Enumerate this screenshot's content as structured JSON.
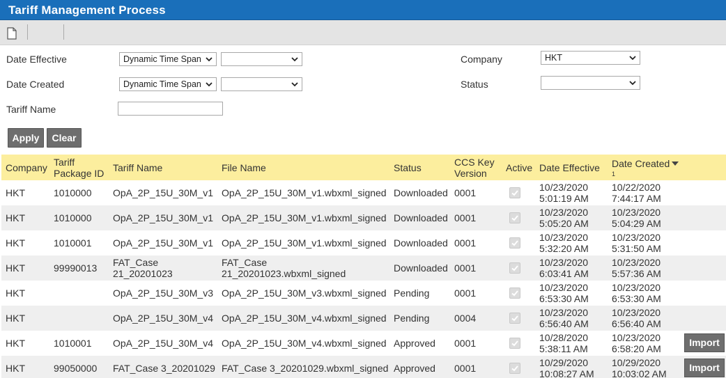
{
  "window": {
    "title": "Tariff Management Process"
  },
  "toolbar": {
    "new_icon": "new-document-icon"
  },
  "filters": {
    "date_effective": {
      "label": "Date Effective",
      "mode": "Dynamic Time Span",
      "range": ""
    },
    "date_created": {
      "label": "Date Created",
      "mode": "Dynamic Time Span",
      "range": ""
    },
    "tariff_name": {
      "label": "Tariff Name",
      "value": ""
    },
    "company": {
      "label": "Company",
      "value": "HKT"
    },
    "status": {
      "label": "Status",
      "value": ""
    }
  },
  "actions": {
    "apply": "Apply",
    "clear": "Clear"
  },
  "table": {
    "columns": {
      "company": "Company",
      "package_id_1": "Tariff",
      "package_id_2": "Package ID",
      "tariff_name": "Tariff Name",
      "file_name": "File Name",
      "status": "Status",
      "ccs_1": "CCS Key",
      "ccs_2": "Version",
      "active": "Active",
      "date_effective": "Date Effective",
      "date_created": "Date Created",
      "sort_order": "1"
    },
    "rows": [
      {
        "company": "HKT",
        "package_id": "1010000",
        "tariff_name": [
          "OpA_2P_15U_30M_v1"
        ],
        "file_name": [
          "OpA_2P_15U_30M_v1.wbxml_signed"
        ],
        "status": "Downloaded",
        "ccs": "0001",
        "active": true,
        "eff_date": "10/23/2020",
        "eff_time": "5:01:19 AM",
        "cre_date": "10/22/2020",
        "cre_time": "7:44:17 AM",
        "import": ""
      },
      {
        "company": "HKT",
        "package_id": "1010000",
        "tariff_name": [
          "OpA_2P_15U_30M_v1"
        ],
        "file_name": [
          "OpA_2P_15U_30M_v1.wbxml_signed"
        ],
        "status": "Downloaded",
        "ccs": "0001",
        "active": true,
        "eff_date": "10/23/2020",
        "eff_time": "5:05:20 AM",
        "cre_date": "10/23/2020",
        "cre_time": "5:04:29 AM",
        "import": ""
      },
      {
        "company": "HKT",
        "package_id": "1010001",
        "tariff_name": [
          "OpA_2P_15U_30M_v1"
        ],
        "file_name": [
          "OpA_2P_15U_30M_v1.wbxml_signed"
        ],
        "status": "Downloaded",
        "ccs": "0001",
        "active": true,
        "eff_date": "10/23/2020",
        "eff_time": "5:32:20 AM",
        "cre_date": "10/23/2020",
        "cre_time": "5:31:50 AM",
        "import": ""
      },
      {
        "company": "HKT",
        "package_id": "99990013",
        "tariff_name": [
          "FAT_Case",
          "21_20201023"
        ],
        "file_name": [
          "FAT_Case",
          "21_20201023.wbxml_signed"
        ],
        "status": "Downloaded",
        "ccs": "0001",
        "active": true,
        "eff_date": "10/23/2020",
        "eff_time": "6:03:41 AM",
        "cre_date": "10/23/2020",
        "cre_time": "5:57:36 AM",
        "import": ""
      },
      {
        "company": "HKT",
        "package_id": "",
        "tariff_name": [
          "OpA_2P_15U_30M_v3"
        ],
        "file_name": [
          "OpA_2P_15U_30M_v3.wbxml_signed"
        ],
        "status": "Pending",
        "ccs": "0001",
        "active": true,
        "eff_date": "10/23/2020",
        "eff_time": "6:53:30 AM",
        "cre_date": "10/23/2020",
        "cre_time": "6:53:30 AM",
        "import": ""
      },
      {
        "company": "HKT",
        "package_id": "",
        "tariff_name": [
          "OpA_2P_15U_30M_v4"
        ],
        "file_name": [
          "OpA_2P_15U_30M_v4.wbxml_signed"
        ],
        "status": "Pending",
        "ccs": "0004",
        "active": true,
        "eff_date": "10/23/2020",
        "eff_time": "6:56:40 AM",
        "cre_date": "10/23/2020",
        "cre_time": "6:56:40 AM",
        "import": ""
      },
      {
        "company": "HKT",
        "package_id": "1010001",
        "tariff_name": [
          "OpA_2P_15U_30M_v4"
        ],
        "file_name": [
          "OpA_2P_15U_30M_v4.wbxml_signed"
        ],
        "status": "Approved",
        "ccs": "0001",
        "active": true,
        "eff_date": "10/28/2020",
        "eff_time": "5:38:11 AM",
        "cre_date": "10/23/2020",
        "cre_time": "6:58:20 AM",
        "import": "Import"
      },
      {
        "company": "HKT",
        "package_id": "99050000",
        "tariff_name": [
          "FAT_Case 3_20201029"
        ],
        "file_name": [
          "FAT_Case 3_20201029.wbxml_signed"
        ],
        "status": "Approved",
        "ccs": "0001",
        "active": true,
        "eff_date": "10/29/2020",
        "eff_time": "10:08:27 AM",
        "cre_date": "10/29/2020",
        "cre_time": "10:03:02 AM",
        "import": "Import"
      }
    ]
  }
}
